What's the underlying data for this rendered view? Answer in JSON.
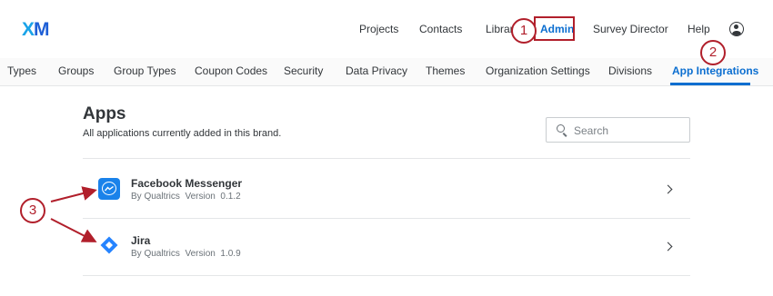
{
  "brand": {
    "logo_text_a": "X",
    "logo_text_b": "M"
  },
  "topnav": {
    "items": [
      "Projects",
      "Contacts",
      "Library",
      "Admin",
      "Survey Director",
      "Help"
    ],
    "active": "Admin"
  },
  "subnav": {
    "items": [
      "Types",
      "Groups",
      "Group Types",
      "Coupon Codes",
      "Security",
      "Data Privacy",
      "Themes",
      "Organization Settings",
      "Divisions",
      "App Integrations"
    ],
    "active": "App Integrations"
  },
  "page": {
    "title": "Apps",
    "subtitle": "All applications currently added in this brand."
  },
  "search": {
    "placeholder": "Search",
    "value": ""
  },
  "apps": [
    {
      "name": "Facebook Messenger",
      "publisher": "By Qualtrics",
      "version_label": "Version",
      "version": "0.1.2",
      "icon": "messenger-icon"
    },
    {
      "name": "Jira",
      "publisher": "By Qualtrics",
      "version_label": "Version",
      "version": "1.0.9",
      "icon": "jira-icon"
    }
  ],
  "callouts": [
    "1",
    "2",
    "3"
  ],
  "colors": {
    "accent": "#0b6ed0",
    "callout": "#b11f2b",
    "messenger": "#1a82ea",
    "jira": "#2684ff"
  }
}
